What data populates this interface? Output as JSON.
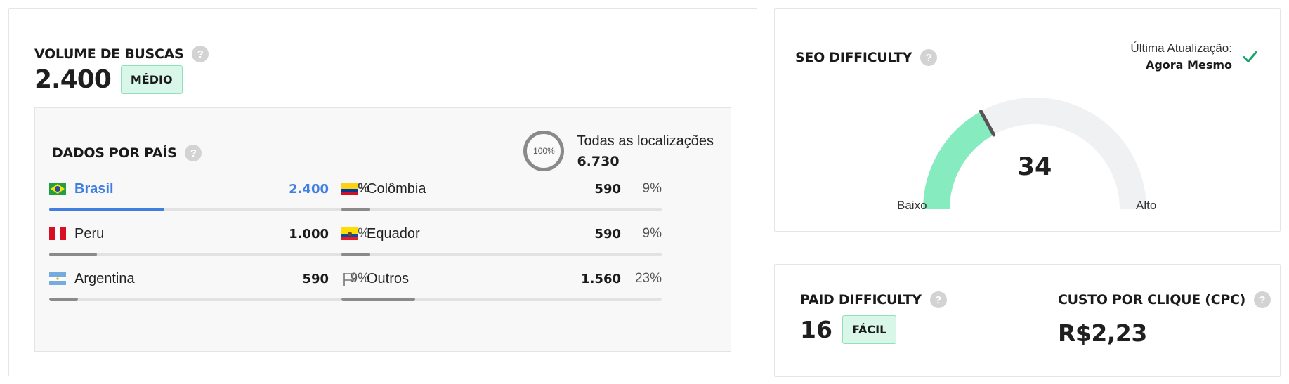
{
  "volume": {
    "title": "VOLUME DE BUSCAS",
    "value": "2.400",
    "level_badge": "MÉDIO"
  },
  "countries": {
    "title": "DADOS POR PAÍS",
    "all_locations": {
      "percent_label": "100%",
      "label": "Todas as localizações",
      "value": "6.730"
    },
    "items": [
      {
        "name": "Brasil",
        "value": "2.400",
        "percent": "36%",
        "share": 0.36,
        "flag": "brazil-flag-icon",
        "active": true
      },
      {
        "name": "Colômbia",
        "value": "590",
        "percent": "9%",
        "share": 0.09,
        "flag": "colombia-flag-icon"
      },
      {
        "name": "Peru",
        "value": "1.000",
        "percent": "15%",
        "share": 0.15,
        "flag": "peru-flag-icon"
      },
      {
        "name": "Equador",
        "value": "590",
        "percent": "9%",
        "share": 0.09,
        "flag": "ecuador-flag-icon"
      },
      {
        "name": "Argentina",
        "value": "590",
        "percent": "9%",
        "share": 0.09,
        "flag": "argentina-flag-icon"
      },
      {
        "name": "Outros",
        "value": "1.560",
        "percent": "23%",
        "share": 0.23,
        "flag": "outline-flag-icon"
      }
    ]
  },
  "seo": {
    "title": "SEO DIFFICULTY",
    "updated_label": "Última Atualização:",
    "updated_value": "Agora Mesmo",
    "score": "34",
    "score_fraction": 0.34,
    "low_label": "Baixo",
    "high_label": "Alto",
    "fill_color": "#86ecc0",
    "track_color": "#f0f1f2"
  },
  "paid": {
    "title": "PAID DIFFICULTY",
    "value": "16",
    "level_badge": "FÁCIL"
  },
  "cpc": {
    "title": "CUSTO POR CLIQUE (CPC)",
    "value": "R$2,23"
  },
  "colors": {
    "accent_blue": "#3f7fe0",
    "badge_green_bg": "#d9f7e8",
    "check_green": "#1aa36b"
  },
  "help_icon_glyph": "?"
}
